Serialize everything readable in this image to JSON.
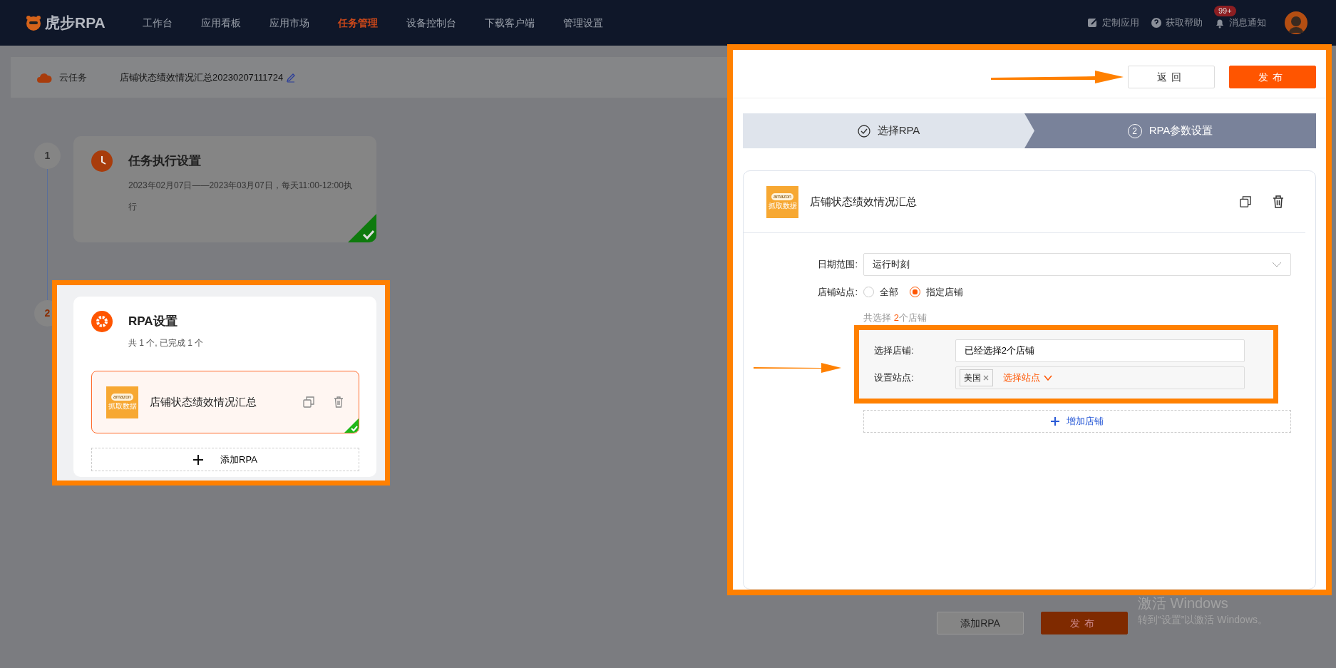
{
  "nav": {
    "brand": "虎步RPA",
    "items": [
      {
        "label": "工作台",
        "selected": false
      },
      {
        "label": "应用看板",
        "selected": false
      },
      {
        "label": "应用市场",
        "selected": false
      },
      {
        "label": "任务管理",
        "selected": true
      },
      {
        "label": "设备控制台",
        "selected": false
      },
      {
        "label": "下载客户端",
        "selected": false
      },
      {
        "label": "管理设置",
        "selected": false
      }
    ],
    "actions": [
      {
        "label": "定制应用",
        "kind": "customize"
      },
      {
        "label": "获取帮助",
        "kind": "help"
      },
      {
        "label": "消息通知",
        "kind": "notifications",
        "badge": "99+"
      }
    ]
  },
  "task": {
    "type": "云任务",
    "name": "店铺状态绩效情况汇总20230207111724"
  },
  "steps": [
    {
      "number": "1",
      "kind": "schedule",
      "current": false,
      "highlighted": false,
      "title": "任务执行设置",
      "description": "2023年02月07日——2023年03月07日，每天11:00-12:00执行",
      "done": true
    },
    {
      "number": "2",
      "kind": "rpa",
      "current": true,
      "highlighted": true,
      "title": "RPA设置",
      "description": "共 1 个, 已完成 1 个",
      "rpa_items": [
        {
          "name": "店铺状态绩效情况汇总",
          "logo": [
            "amazon",
            "抓取数据"
          ],
          "done": true
        }
      ],
      "add_label": "添加RPA"
    }
  ],
  "footer": {
    "buttons": [
      {
        "label": "添加RPA",
        "kind": "secondary"
      },
      {
        "label": "发布",
        "kind": "primary"
      }
    ]
  },
  "drawer": {
    "highlighted": true,
    "buttons": [
      {
        "label": "返回",
        "kind": "secondary"
      },
      {
        "label": "发布",
        "kind": "primary"
      }
    ],
    "wizard": [
      {
        "label": "选择RPA",
        "done": true,
        "selected": false
      },
      {
        "number": "2",
        "label": "RPA参数设置",
        "done": false,
        "selected": true
      }
    ],
    "rpa": {
      "name": "店铺状态绩效情况汇总",
      "logo": [
        "amazon",
        "抓取数据"
      ],
      "fields": [
        {
          "kind": "select",
          "label": "日期范围:",
          "value": "运行时刻"
        },
        {
          "kind": "radio",
          "label": "店铺站点:",
          "options": [
            {
              "label": "全部",
              "selected": false
            },
            {
              "label": "指定店铺",
              "selected": true
            }
          ]
        }
      ],
      "summary": {
        "prefix": "共选择 ",
        "count": "2",
        "suffix": "个店铺"
      },
      "store_group": {
        "highlighted": true,
        "store": {
          "label": "选择店铺:",
          "value": "已经选择2个店铺"
        },
        "site": {
          "label": "设置站点:",
          "tags": [
            "美国"
          ],
          "picker": "选择站点"
        }
      },
      "add_store": "增加店铺"
    }
  },
  "activation": {
    "title": "激活 Windows",
    "text": "转到“设置”以激活 Windows。"
  }
}
